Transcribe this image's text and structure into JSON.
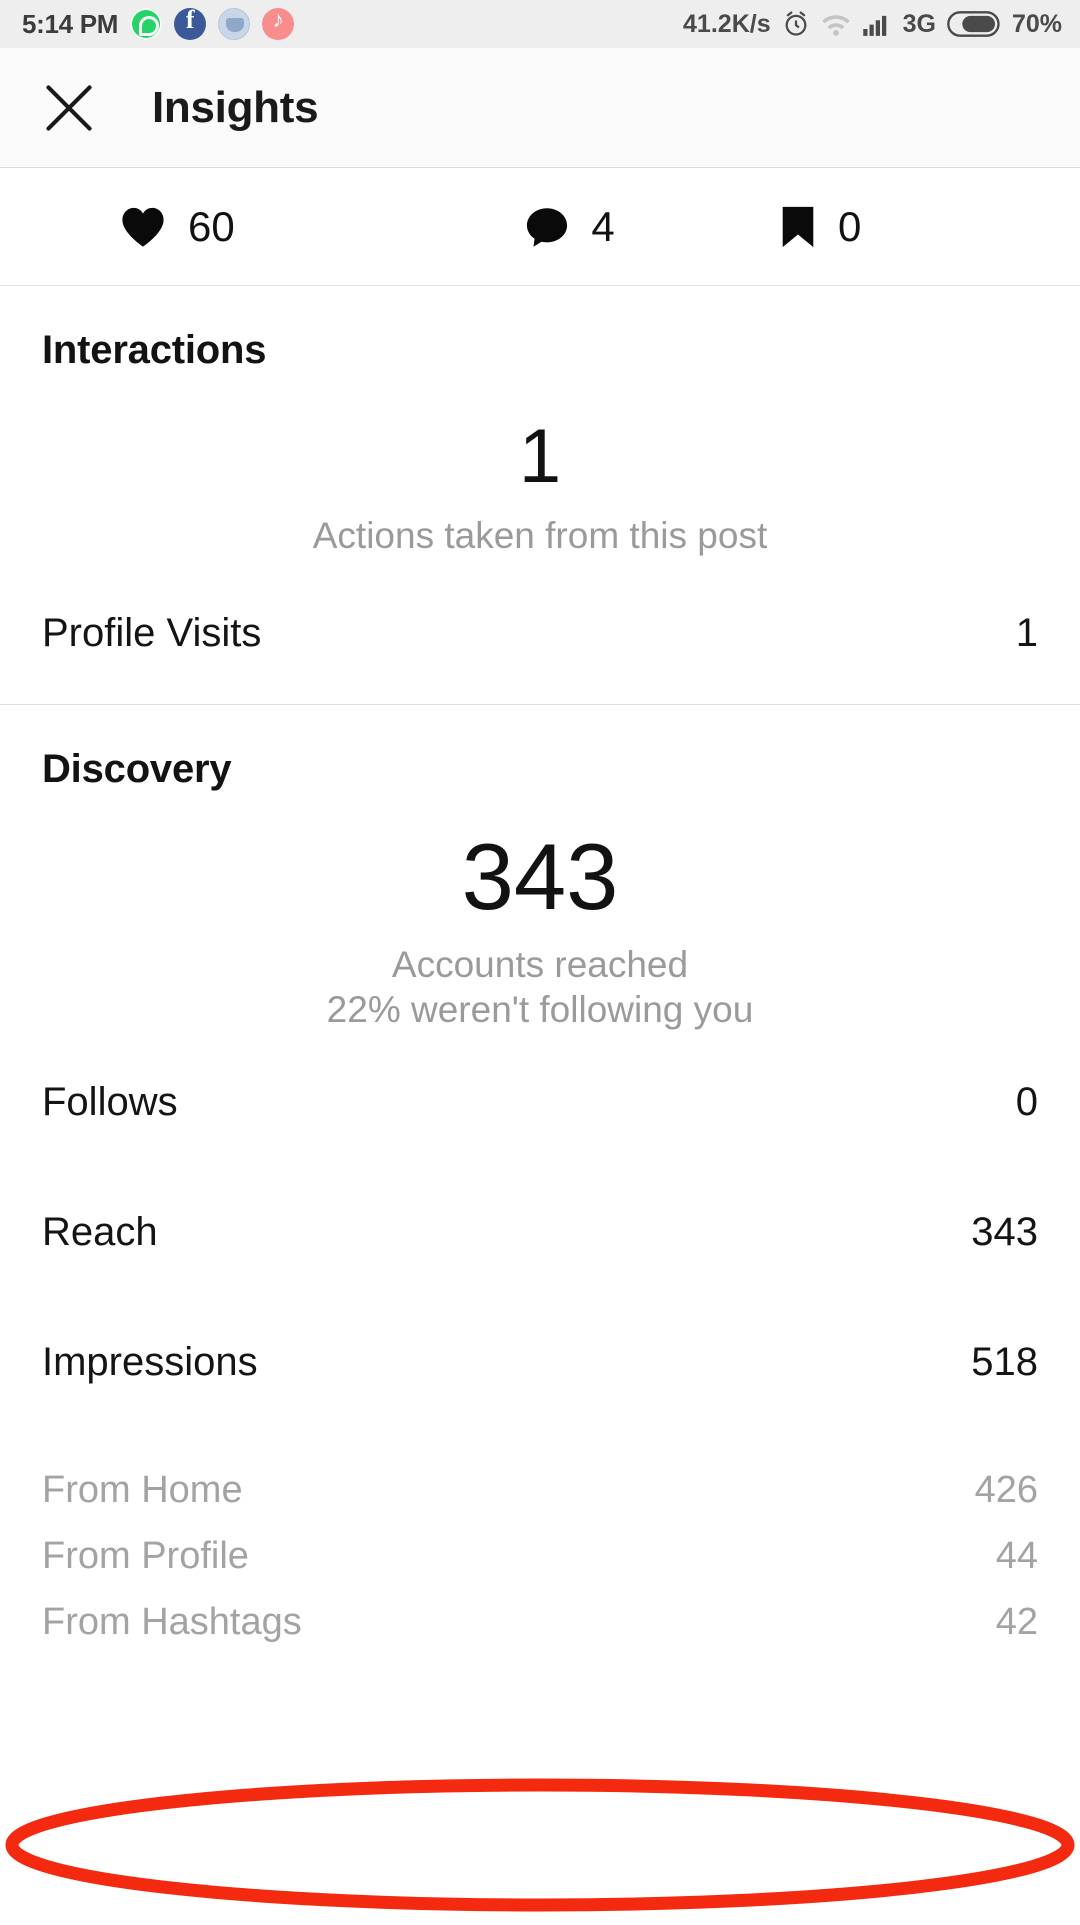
{
  "statusbar": {
    "time": "5:14 PM",
    "app_icons": [
      "whatsapp-icon",
      "facebook-icon",
      "blue-app-icon",
      "tiktok-icon"
    ],
    "network_speed": "41.2K/s",
    "alarm_icon": "alarm-clock-icon",
    "wifi_icon": "wifi-icon",
    "signal_icon": "cellular-signal-icon",
    "network_type": "3G",
    "battery_icon": "battery-icon",
    "battery_percent": "70%"
  },
  "header": {
    "close_icon": "close-icon",
    "title": "Insights"
  },
  "engagement": {
    "likes": {
      "icon": "heart-icon",
      "value": "60"
    },
    "comments": {
      "icon": "comment-icon",
      "value": "4"
    },
    "saves": {
      "icon": "bookmark-icon",
      "value": "0"
    }
  },
  "interactions": {
    "title": "Interactions",
    "hero_value": "1",
    "hero_caption": "Actions taken from this post",
    "rows": [
      {
        "label": "Profile Visits",
        "value": "1",
        "muted": false
      }
    ]
  },
  "discovery": {
    "title": "Discovery",
    "hero_value": "343",
    "hero_caption_line1": "Accounts reached",
    "hero_caption_line2": "22% weren't following you",
    "rows": [
      {
        "label": "Follows",
        "value": "0",
        "muted": false
      },
      {
        "label": "Reach",
        "value": "343",
        "muted": false
      },
      {
        "label": "Impressions",
        "value": "518",
        "muted": false
      },
      {
        "label": "From Home",
        "value": "426",
        "muted": true
      },
      {
        "label": "From Profile",
        "value": "44",
        "muted": true
      },
      {
        "label": "From Hashtags",
        "value": "42",
        "muted": true
      }
    ]
  },
  "annotation": {
    "shape": "ellipse-highlight",
    "color": "#F42A10",
    "targets": "From Hashtags"
  }
}
